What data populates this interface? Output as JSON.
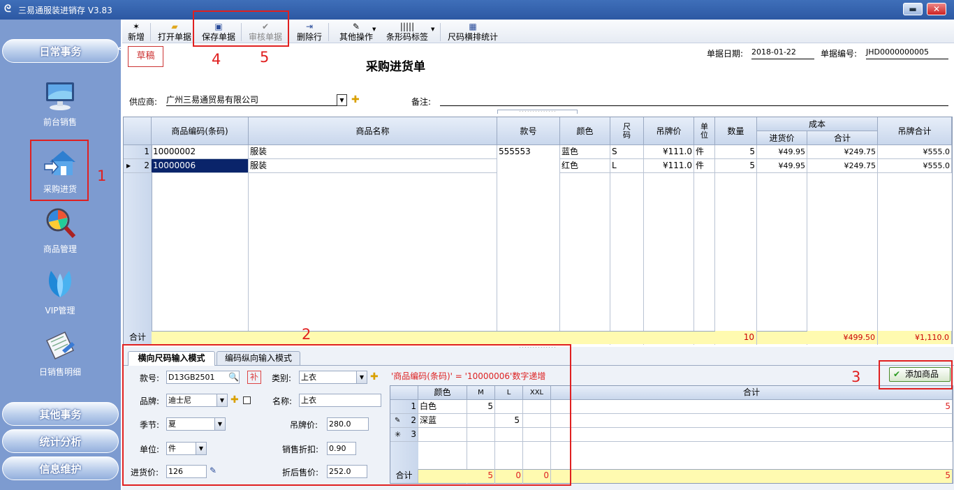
{
  "app": {
    "title": "三易通服装进销存 V3.83",
    "min": "▬",
    "close": "✕"
  },
  "sidebar": {
    "collapse": "<<",
    "top_button": "日常事务",
    "items": [
      {
        "label": "前台销售",
        "icon": "monitor-icon"
      },
      {
        "label": "采购进货",
        "icon": "house-arrow-icon"
      },
      {
        "label": "商品管理",
        "icon": "magnifier-chart-icon"
      },
      {
        "label": "VIP管理",
        "icon": "vip-leaf-icon"
      },
      {
        "label": "日销售明细",
        "icon": "daily-sales-icon"
      }
    ],
    "bottom_buttons": [
      "其他事务",
      "统计分析",
      "信息维护"
    ]
  },
  "toolbar": {
    "items": [
      "新增",
      "打开单据",
      "保存单据",
      "审核单据",
      "删除行",
      "其他操作",
      "条形码标签",
      "尺码横排统计"
    ]
  },
  "form": {
    "status": "草稿",
    "title": "采购进货单",
    "date_label": "单据日期:",
    "date_value": "2018-01-22",
    "number_label": "单据编号:",
    "number_value": "JHD0000000005",
    "supplier_label": "供应商:",
    "supplier_value": "广州三易通贸易有限公司",
    "remark_label": "备注:",
    "remark_value": ""
  },
  "grid": {
    "headers": {
      "code": "商品编码(条码)",
      "name": "商品名称",
      "style": "款号",
      "color": "颜色",
      "size": "尺码",
      "price": "吊牌价",
      "unit": "单位",
      "qty": "数量",
      "cost": "成本",
      "cost_price": "进货价",
      "cost_total": "合计",
      "tag_total": "吊牌合计"
    },
    "rows": [
      {
        "no": "1",
        "code": "10000002",
        "name": "服装",
        "style": "555553",
        "color": "蓝色",
        "size": "S",
        "price": "¥111.0",
        "unit": "件",
        "qty": "5",
        "cost_price": "¥49.95",
        "cost_total": "¥249.75",
        "tag_total": "¥555.0"
      },
      {
        "no": "2",
        "code": "10000006",
        "name": "服装",
        "style": "",
        "color": "红色",
        "size": "L",
        "price": "¥111.0",
        "unit": "件",
        "qty": "5",
        "cost_price": "¥49.95",
        "cost_total": "¥249.75",
        "tag_total": "¥555.0"
      }
    ],
    "sum_label": "合计",
    "sum_qty": "10",
    "sum_cost": "¥499.50",
    "sum_tag": "¥1,110.0"
  },
  "entry": {
    "tabs": [
      "横向尺码输入模式",
      "编码纵向输入模式"
    ],
    "style_label": "款号:",
    "style_value": "D13GB2501",
    "bu": "补",
    "category_label": "类别:",
    "category_value": "上衣",
    "brand_label": "品牌:",
    "brand_value": "迪士尼",
    "name_label": "名称:",
    "name_value": "上衣",
    "season_label": "季节:",
    "season_value": "夏",
    "tag_price_label": "吊牌价:",
    "tag_price_value": "280.0",
    "unit_label": "单位:",
    "unit_value": "件",
    "discount_label": "销售折扣:",
    "discount_value": "0.90",
    "cost_label": "进货价:",
    "cost_value": "126",
    "after_label": "折后售价:",
    "after_value": "252.0",
    "hint": "'商品编码(条码)' = '10000006'数字递增",
    "add_button": "添加商品",
    "size_grid": {
      "headers": [
        "颜色",
        "M",
        "L",
        "XXL",
        "合计"
      ],
      "rows": [
        {
          "no": "1",
          "color": "白色",
          "M": "5",
          "L": "",
          "XXL": "",
          "total": "5"
        },
        {
          "no": "2",
          "color": "深蓝",
          "M": "",
          "L": "5",
          "XXL": "",
          "total": ""
        },
        {
          "no": "3",
          "color": "",
          "M": "",
          "L": "",
          "XXL": "",
          "total": ""
        }
      ],
      "sum_label": "合计",
      "sum_M": "5",
      "sum_L": "0",
      "sum_XXL": "0",
      "sum_total": "5"
    }
  },
  "annotations": [
    "1",
    "2",
    "3",
    "4",
    "5"
  ]
}
